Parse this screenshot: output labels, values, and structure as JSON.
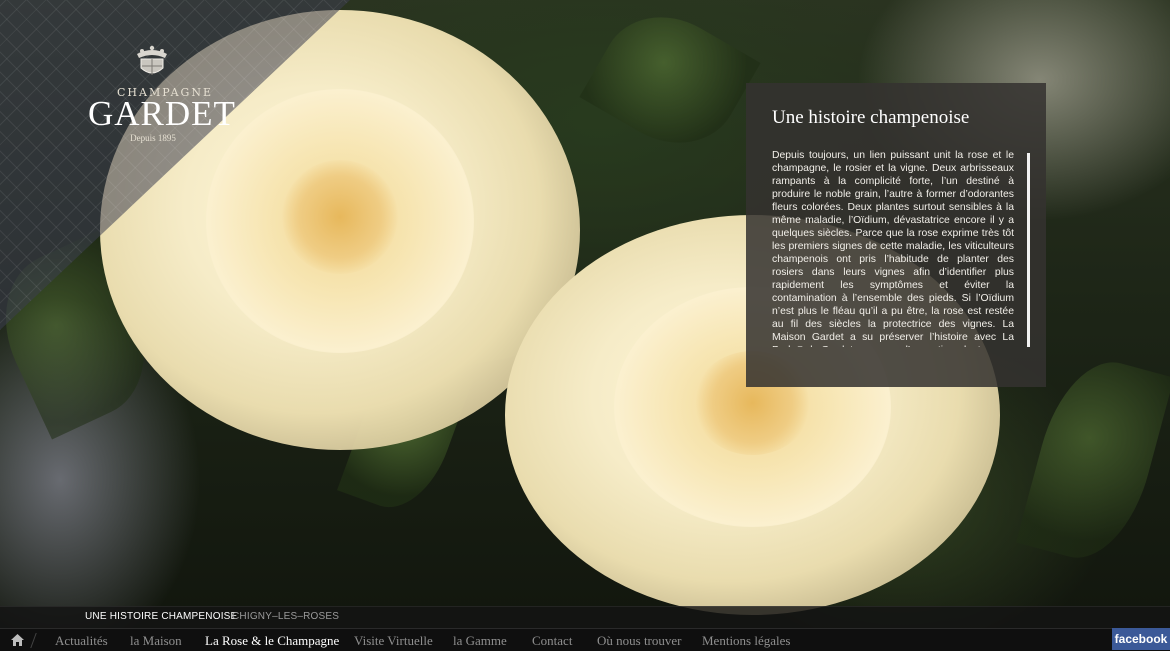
{
  "logo": {
    "small_text": "CHAMPAGNE",
    "big_text": "GARDET",
    "since": "Depuis 1895"
  },
  "panel": {
    "title": "Une histoire champenoise",
    "body": "Depuis toujours, un lien puissant unit la rose et le champagne, le rosier et la vigne. Deux arbrisseaux rampants à la complicité forte, l’un destiné à produire le noble grain, l’autre à former d’odorantes fleurs colorées. Deux plantes surtout sensibles à la même maladie, l’Oïdium, dévastatrice encore il y a quelques siècles. Parce que la rose exprime très tôt les premiers signes de cette maladie, les viticulteurs champenois ont pris l’habitude de planter des rosiers dans leurs vignes afin d’identifier plus rapidement les symptômes et éviter la contamination à l’ensemble des pieds. Si l’Oïdium n’est plus le fléau qu’il a pu être, la rose est restée au fil des siècles la protectrice des vignes. La Maison Gardet a su préserver l’histoire avec La Perla® de Gardet, une rose d’exception, dont"
  },
  "subnav": {
    "items": [
      "UNE HISTOIRE CHAMPENOISE",
      "CHIGNY–LES–ROSES"
    ],
    "active_index": 0
  },
  "mainnav": {
    "home_icon": "home-icon",
    "items": [
      "Actualités",
      "la Maison",
      "La Rose & le Champagne",
      "Visite Virtuelle",
      "la Gamme",
      "Contact",
      "Où nous trouver",
      "Mentions légales"
    ],
    "active_index": 2
  },
  "social": {
    "facebook_label": "facebook",
    "facebook_color": "#3b5998"
  }
}
